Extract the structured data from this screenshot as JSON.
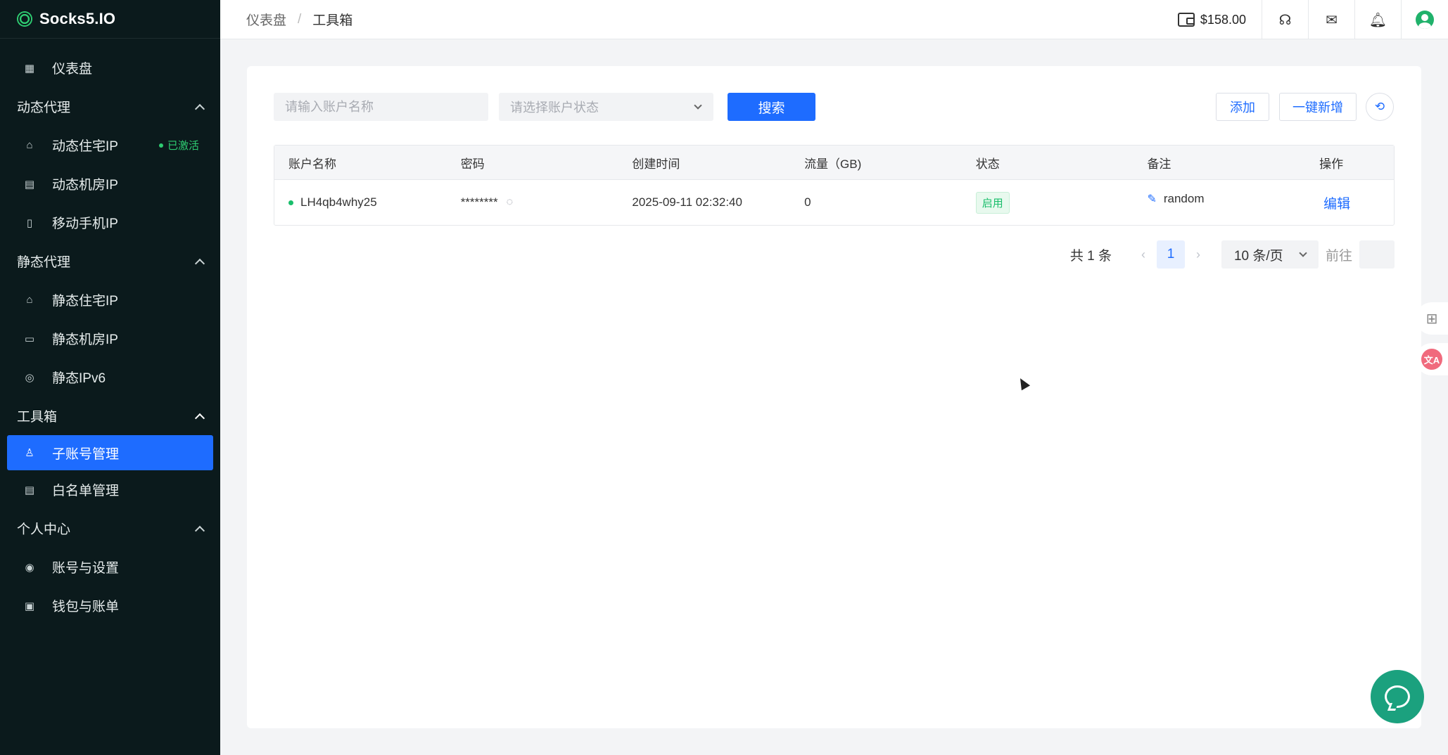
{
  "brand": {
    "name": "Socks5.IO"
  },
  "sidebar": {
    "items": [
      {
        "type": "item",
        "label": "仪表盘",
        "icon": "dashboard-icon"
      },
      {
        "type": "group",
        "label": "动态代理"
      },
      {
        "type": "item",
        "label": "动态住宅IP",
        "icon": "residential-icon",
        "badge": "已激活"
      },
      {
        "type": "item",
        "label": "动态机房IP",
        "icon": "server-icon"
      },
      {
        "type": "item",
        "label": "移动手机IP",
        "icon": "mobile-icon"
      },
      {
        "type": "group",
        "label": "静态代理"
      },
      {
        "type": "item",
        "label": "静态住宅IP",
        "icon": "home-icon"
      },
      {
        "type": "item",
        "label": "静态机房IP",
        "icon": "datacenter-icon"
      },
      {
        "type": "item",
        "label": "静态IPv6",
        "icon": "globe-icon"
      },
      {
        "type": "group",
        "label": "工具箱"
      },
      {
        "type": "item",
        "label": "子账号管理",
        "icon": "subaccount-icon",
        "active": true
      },
      {
        "type": "item",
        "label": "白名单管理",
        "icon": "whitelist-icon"
      },
      {
        "type": "group",
        "label": "个人中心"
      },
      {
        "type": "item",
        "label": "账号与设置",
        "icon": "user-settings-icon"
      },
      {
        "type": "item",
        "label": "钱包与账单",
        "icon": "wallet-icon"
      }
    ]
  },
  "topbar": {
    "breadcrumb": [
      "仪表盘",
      "工具箱"
    ],
    "separator": "/",
    "balance": "$158.00"
  },
  "filters": {
    "name_placeholder": "请输入账户名称",
    "status_placeholder": "请选择账户状态",
    "search_label": "搜索",
    "add_label": "添加",
    "quick_add_label": "一键新增"
  },
  "table": {
    "headers": [
      "账户名称",
      "密码",
      "创建时间",
      "流量（GB)",
      "状态",
      "备注",
      "操作"
    ],
    "rows": [
      {
        "name": "LH4qb4why25",
        "password": "********",
        "created": "2025-09-11 02:32:40",
        "traffic": "0",
        "status": "启用",
        "remark": "random",
        "action": "编辑"
      }
    ]
  },
  "pagination": {
    "total": "共 1 条",
    "current_page": "1",
    "page_size": "10 条/页",
    "goto": "前往"
  },
  "colors": {
    "primary": "#1e6cff",
    "sidebar_bg": "#0b1a1c",
    "success": "#19be6b",
    "chat": "#1ba17e"
  }
}
